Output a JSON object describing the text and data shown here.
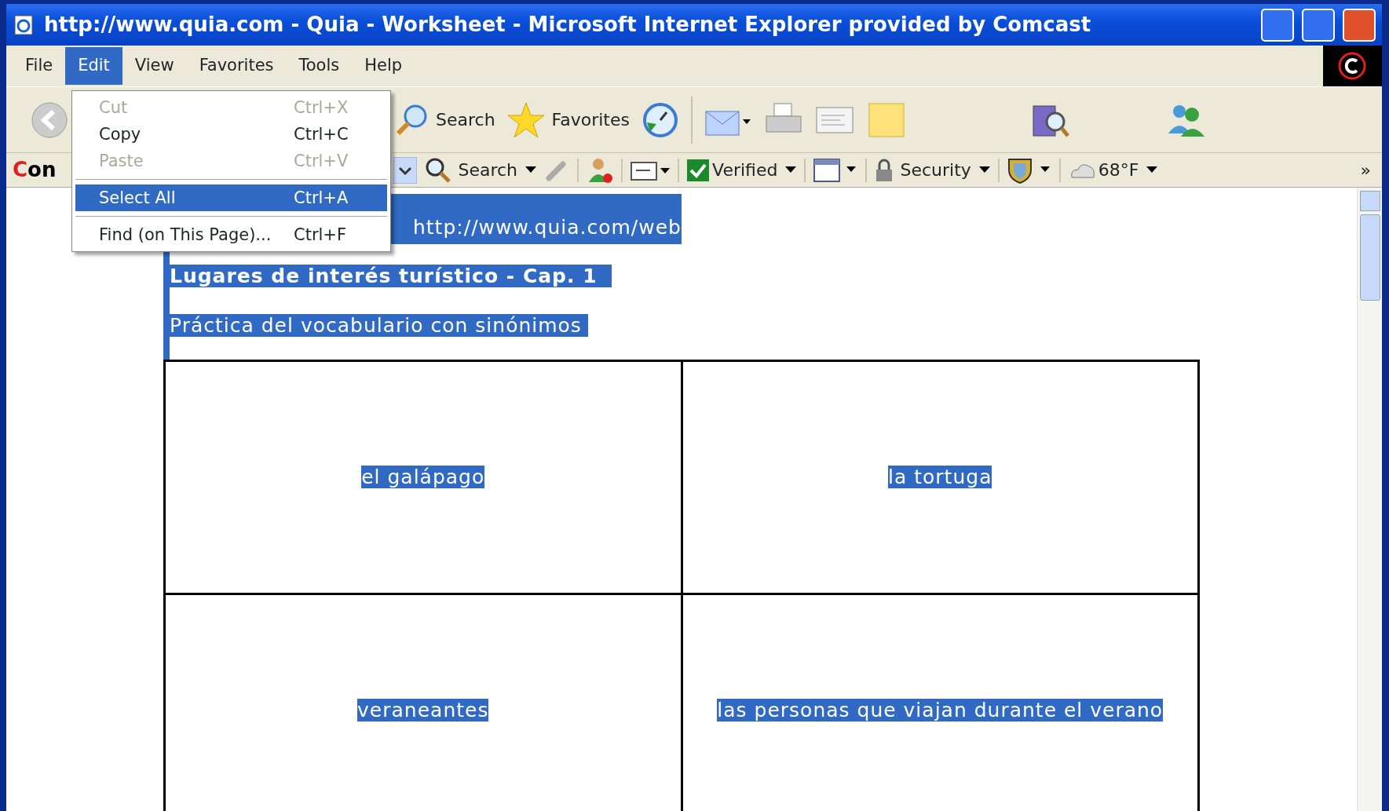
{
  "window": {
    "title": "http://www.quia.com - Quia - Worksheet - Microsoft Internet Explorer provided by Comcast"
  },
  "menu_bar": [
    {
      "label": "File",
      "selected": false
    },
    {
      "label": "Edit",
      "selected": true
    },
    {
      "label": "View",
      "selected": false
    },
    {
      "label": "Favorites",
      "selected": false
    },
    {
      "label": "Tools",
      "selected": false
    },
    {
      "label": "Help",
      "selected": false
    }
  ],
  "edit_menu": [
    {
      "kind": "item",
      "label": "Cut",
      "shortcut": "Ctrl+X",
      "disabled": true,
      "selected": false
    },
    {
      "kind": "item",
      "label": "Copy",
      "shortcut": "Ctrl+C",
      "disabled": false,
      "selected": false
    },
    {
      "kind": "item",
      "label": "Paste",
      "shortcut": "Ctrl+V",
      "disabled": true,
      "selected": false
    },
    {
      "kind": "separator"
    },
    {
      "kind": "item",
      "label": "Select All",
      "shortcut": "Ctrl+A",
      "disabled": false,
      "selected": true
    },
    {
      "kind": "separator"
    },
    {
      "kind": "item",
      "label": "Find (on This Page)...",
      "shortcut": "Ctrl+F",
      "disabled": false,
      "selected": false
    }
  ],
  "toolbar": {
    "search": "Search",
    "favorites": "Favorites"
  },
  "comcast_bar": {
    "logo": "Con",
    "search": "Search",
    "verified": "Verified",
    "security": "Security",
    "weather": "68°F",
    "overflow": "»"
  },
  "page": {
    "selected": true,
    "url": "http://www.quia.com/web",
    "heading": "Lugares de interés turístico - Cap. 1",
    "subheading": "Práctica del vocabulario con sinónimos",
    "table": {
      "rows": [
        [
          "el galápago",
          "la tortuga"
        ],
        [
          "veraneantes",
          "las personas que viajan durante el verano"
        ]
      ]
    }
  }
}
